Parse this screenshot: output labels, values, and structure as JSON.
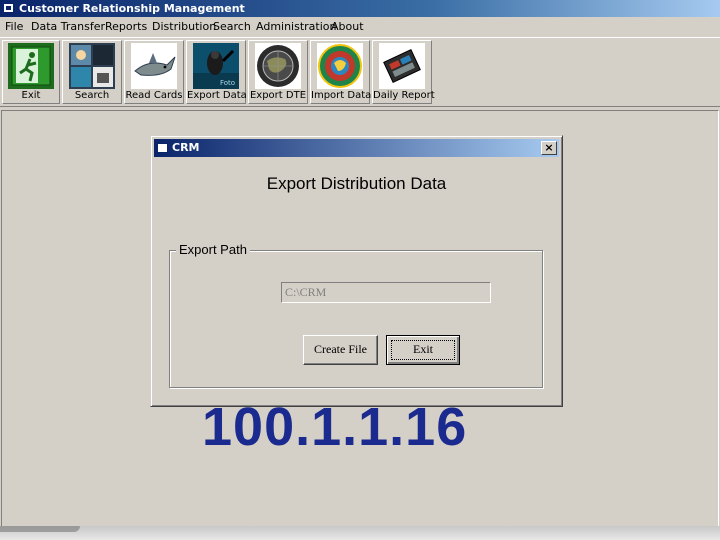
{
  "window": {
    "title": "Customer Relationship Management"
  },
  "menu": [
    "File",
    "Data Transfer",
    "Reports",
    "Distribution",
    "Search",
    "Administration",
    "About"
  ],
  "toolbar": [
    {
      "label": "Exit",
      "icon": "exit-door-icon"
    },
    {
      "label": "Search",
      "icon": "search-collage-icon"
    },
    {
      "label": "Read Cards",
      "icon": "shark-icon"
    },
    {
      "label": "Export Data",
      "icon": "diver-icon"
    },
    {
      "label": "Export DTE",
      "icon": "globe-dark-icon"
    },
    {
      "label": "Import Data",
      "icon": "globe-colorful-icon"
    },
    {
      "label": "Daily Report",
      "icon": "report-machine-icon"
    }
  ],
  "background_text": "100.1.1.16",
  "dialog": {
    "title": "CRM",
    "close_label": "×",
    "heading": "Export Distribution Data",
    "group_label": "Export Path",
    "path_value": "C:\\CRM",
    "create_button": "Create File",
    "exit_button": "Exit"
  },
  "colors": {
    "title_bar_start": "#0a246a",
    "ip_text": "#1a2a8e",
    "face": "#d4d0c8"
  }
}
